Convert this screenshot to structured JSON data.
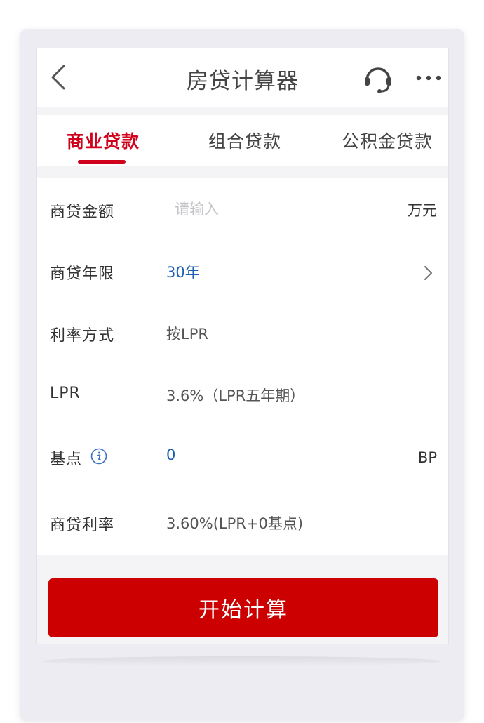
{
  "header": {
    "title": "房贷计算器",
    "back_icon": "chevron-left-icon",
    "service_icon": "headset-icon",
    "more_icon": "more-dots-icon"
  },
  "tabs": [
    {
      "label": "商业贷款",
      "active": true
    },
    {
      "label": "组合贷款",
      "active": false
    },
    {
      "label": "公积金贷款",
      "active": false
    }
  ],
  "form": {
    "amount": {
      "label": "商贷金额",
      "placeholder": "请输入",
      "unit": "万元"
    },
    "term": {
      "label": "商贷年限",
      "value": "30年"
    },
    "rate_mode": {
      "label": "利率方式",
      "value": "按LPR"
    },
    "lpr": {
      "label": "LPR",
      "value": "3.6%（LPR五年期）"
    },
    "basis_point": {
      "label": "基点",
      "value": "0",
      "unit": "BP",
      "icon": "info-icon"
    },
    "loan_rate": {
      "label": "商贷利率",
      "value": "3.60%(LPR+0基点)"
    }
  },
  "actions": {
    "calculate_label": "开始计算"
  },
  "colors": {
    "accent": "#d0021b",
    "button": "#cc0000",
    "link_blue": "#1a5fb4"
  }
}
